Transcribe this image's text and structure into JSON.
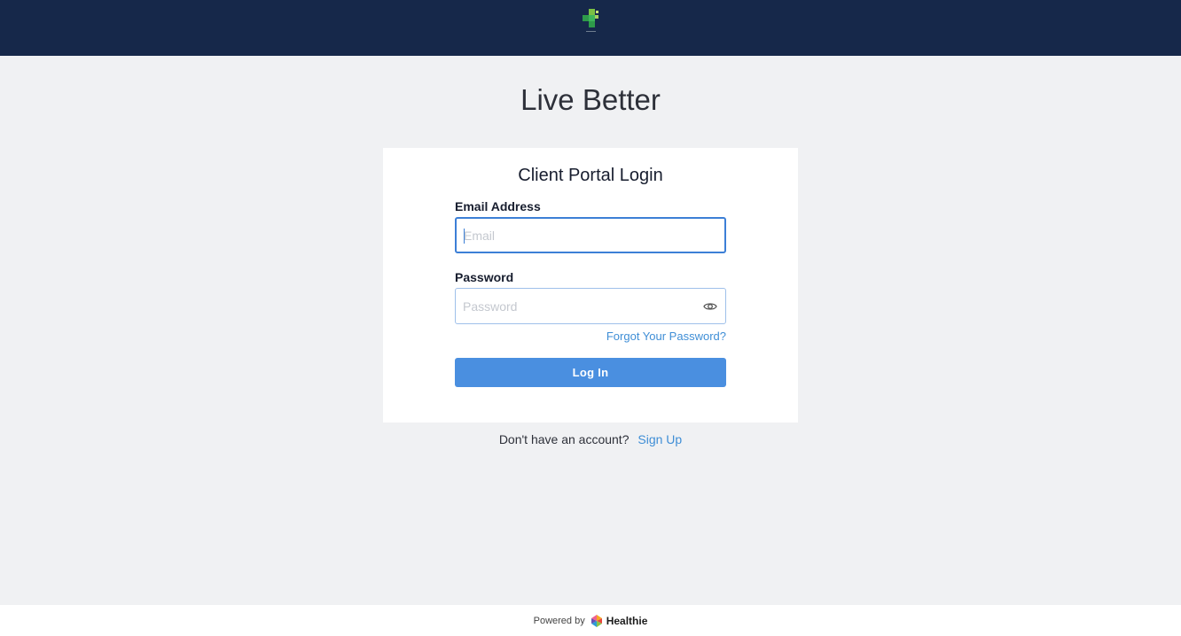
{
  "header": {
    "logo_icon": "green-cross-logo-icon",
    "background": "#16284a"
  },
  "hero": {
    "title": "Live Better"
  },
  "login": {
    "title": "Client Portal Login",
    "email_label": "Email Address",
    "email_placeholder": "Email",
    "email_value": "",
    "password_label": "Password",
    "password_placeholder": "Password",
    "password_value": "",
    "show_password_icon": "eye-icon",
    "forgot_password": "Forgot Your Password?",
    "submit_label": "Log In"
  },
  "signup": {
    "prompt": "Don't have an account?",
    "link": "Sign Up"
  },
  "footer": {
    "powered_by": "Powered by",
    "brand": "Healthie",
    "brand_icon": "healthie-logo-icon"
  },
  "colors": {
    "accent": "#4a8fe0",
    "link": "#3f8ed6",
    "page_background": "#f0f1f3"
  }
}
